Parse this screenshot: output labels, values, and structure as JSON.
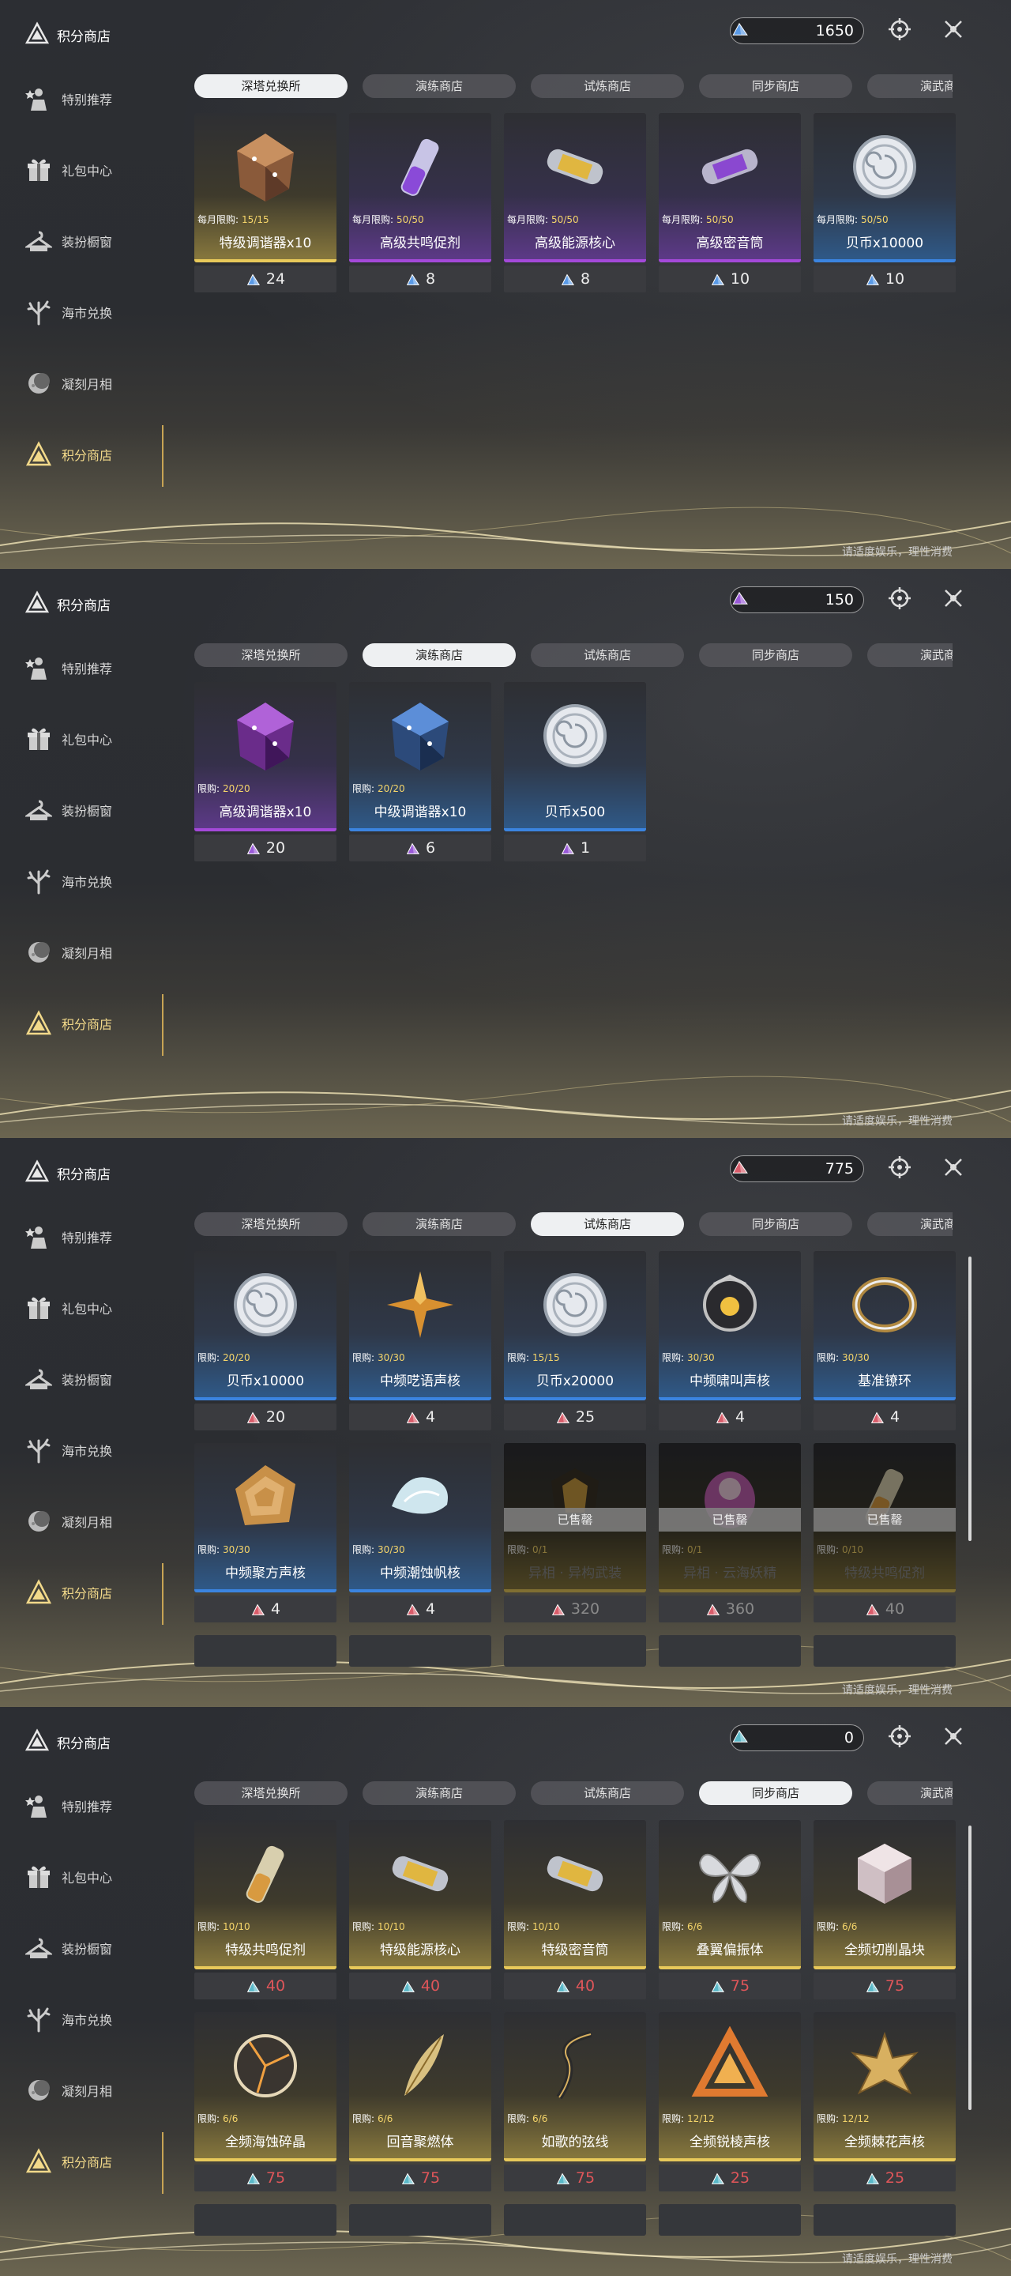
{
  "header": {
    "title": "积分商店",
    "logo_icon": "triangle-logo-icon",
    "target_icon": "crosshair-icon",
    "close_icon": "close-x-icon"
  },
  "sidebar": [
    {
      "label": "特别推荐",
      "icon": "star-person-icon"
    },
    {
      "label": "礼包中心",
      "icon": "gift-icon"
    },
    {
      "label": "装扮橱窗",
      "icon": "hanger-icon"
    },
    {
      "label": "海市兑换",
      "icon": "coral-tree-icon"
    },
    {
      "label": "凝刻月相",
      "icon": "moon-icon"
    },
    {
      "label": "积分商店",
      "icon": "triangle-logo-icon",
      "active": true
    }
  ],
  "tabs": [
    "深塔兑换所",
    "演练商店",
    "试炼商店",
    "同步商店",
    "演武商店"
  ],
  "footer_note": "请适度娱乐，理性消费",
  "colors": {
    "gold_accent": "#c8a454",
    "limit_value": "#f5d56a",
    "blue_bar": "#3b84e0",
    "purple_bar": "#a449d9",
    "red_price": "#e0565a"
  },
  "panels": [
    {
      "active_tab": 0,
      "currency": {
        "amount": "1650",
        "gem_color": "#5a9ae6"
      },
      "items": [
        {
          "limit_label": "每月限购:",
          "limit_value": "15/15",
          "name": "特级调谐器x10",
          "price": "24",
          "bg": "gold",
          "bar": "#e8c95a",
          "art": "crystal-gold"
        },
        {
          "limit_label": "每月限购:",
          "limit_value": "50/50",
          "name": "高级共鸣促剂",
          "price": "8",
          "bg": "purple",
          "bar": "#a449d9",
          "art": "vial-purple"
        },
        {
          "limit_label": "每月限购:",
          "limit_value": "50/50",
          "name": "高级能源核心",
          "price": "8",
          "bg": "purple",
          "bar": "#a449d9",
          "art": "capsule-gold"
        },
        {
          "limit_label": "每月限购:",
          "limit_value": "50/50",
          "name": "高级密音筒",
          "price": "10",
          "bg": "purple",
          "bar": "#a449d9",
          "art": "capsule-purple"
        },
        {
          "limit_label": "每月限购:",
          "limit_value": "50/50",
          "name": "贝币x10000",
          "price": "10",
          "bg": "blue",
          "bar": "#3b84e0",
          "art": "coin"
        }
      ]
    },
    {
      "active_tab": 1,
      "currency": {
        "amount": "150",
        "gem_color": "#9a5ad8"
      },
      "items": [
        {
          "limit_label": "限购:",
          "limit_value": "20/20",
          "name": "高级调谐器x10",
          "price": "20",
          "bg": "purple",
          "bar": "#a449d9",
          "art": "crystal-purple"
        },
        {
          "limit_label": "限购:",
          "limit_value": "20/20",
          "name": "中级调谐器x10",
          "price": "6",
          "bg": "blue",
          "bar": "#3b84e0",
          "art": "crystal-blue"
        },
        {
          "limit_label": "",
          "limit_value": "",
          "name": "贝币x500",
          "price": "1",
          "bg": "blue",
          "bar": "#3b84e0",
          "art": "coin"
        }
      ]
    },
    {
      "active_tab": 2,
      "currency": {
        "amount": "775",
        "gem_color": "#d95c6a"
      },
      "items": [
        {
          "limit_label": "限购:",
          "limit_value": "20/20",
          "name": "贝币x10000",
          "price": "20",
          "bg": "blue",
          "bar": "#3b84e0",
          "art": "coin"
        },
        {
          "limit_label": "限购:",
          "limit_value": "30/30",
          "name": "中频呓语声核",
          "price": "4",
          "bg": "blue",
          "bar": "#3b84e0",
          "art": "star-gold"
        },
        {
          "limit_label": "限购:",
          "limit_value": "15/15",
          "name": "贝币x20000",
          "price": "25",
          "bg": "blue",
          "bar": "#3b84e0",
          "art": "coin"
        },
        {
          "limit_label": "限购:",
          "limit_value": "30/30",
          "name": "中频啸叫声核",
          "price": "4",
          "bg": "blue",
          "bar": "#3b84e0",
          "art": "orb-dark"
        },
        {
          "limit_label": "限购:",
          "limit_value": "30/30",
          "name": "基准镣环",
          "price": "4",
          "bg": "blue",
          "bar": "#3b84e0",
          "art": "ring"
        },
        {
          "limit_label": "限购:",
          "limit_value": "30/30",
          "name": "中频聚方声核",
          "price": "4",
          "bg": "blue",
          "bar": "#3b84e0",
          "art": "spiral-gold"
        },
        {
          "limit_label": "限购:",
          "limit_value": "30/30",
          "name": "中频潮蚀帆核",
          "price": "4",
          "bg": "blue",
          "bar": "#3b84e0",
          "art": "shell"
        },
        {
          "limit_label": "限购:",
          "limit_value": "0/1",
          "name": "异相 · 异构武装",
          "price": "320",
          "bg": "gold",
          "bar": "#e8c95a",
          "art": "armor",
          "sold": "已售罄"
        },
        {
          "limit_label": "限购:",
          "limit_value": "0/1",
          "name": "异相 · 云海妖精",
          "price": "360",
          "bg": "gold",
          "bar": "#e8c95a",
          "art": "fairy",
          "sold": "已售罄"
        },
        {
          "limit_label": "限购:",
          "limit_value": "0/10",
          "name": "特级共鸣促剂",
          "price": "40",
          "bg": "gold",
          "bar": "#e8c95a",
          "art": "vial-gold",
          "sold": "已售罄"
        }
      ]
    },
    {
      "active_tab": 3,
      "currency": {
        "amount": "0",
        "gem_color": "#5ab8c8"
      },
      "price_color": "#e0565a",
      "items": [
        {
          "limit_label": "限购:",
          "limit_value": "10/10",
          "name": "特级共鸣促剂",
          "price": "40",
          "bg": "gold",
          "bar": "#e8c95a",
          "art": "vial-gold"
        },
        {
          "limit_label": "限购:",
          "limit_value": "10/10",
          "name": "特级能源核心",
          "price": "40",
          "bg": "gold",
          "bar": "#e8c95a",
          "art": "capsule-gold"
        },
        {
          "limit_label": "限购:",
          "limit_value": "10/10",
          "name": "特级密音筒",
          "price": "40",
          "bg": "gold",
          "bar": "#e8c95a",
          "art": "capsule-gold"
        },
        {
          "limit_label": "限购:",
          "limit_value": "6/6",
          "name": "叠翼偏振体",
          "price": "75",
          "bg": "gold",
          "bar": "#e8c95a",
          "art": "butterfly"
        },
        {
          "limit_label": "限购:",
          "limit_value": "6/6",
          "name": "全频切削晶块",
          "price": "75",
          "bg": "gold",
          "bar": "#e8c95a",
          "art": "cube"
        },
        {
          "limit_label": "限购:",
          "limit_value": "6/6",
          "name": "全频海蚀碎晶",
          "price": "75",
          "bg": "gold",
          "bar": "#e8c95a",
          "art": "disc-cracked"
        },
        {
          "limit_label": "限购:",
          "limit_value": "6/6",
          "name": "回音聚燃体",
          "price": "75",
          "bg": "gold",
          "bar": "#e8c95a",
          "art": "feather"
        },
        {
          "limit_label": "限购:",
          "limit_value": "6/6",
          "name": "如歌的弦线",
          "price": "75",
          "bg": "gold",
          "bar": "#e8c95a",
          "art": "string"
        },
        {
          "limit_label": "限购:",
          "limit_value": "12/12",
          "name": "全频锐棱声核",
          "price": "25",
          "bg": "gold",
          "bar": "#e8c95a",
          "art": "triangle-gold"
        },
        {
          "limit_label": "限购:",
          "limit_value": "12/12",
          "name": "全频棘花声核",
          "price": "25",
          "bg": "gold",
          "bar": "#e8c95a",
          "art": "flower-gold"
        }
      ]
    }
  ]
}
